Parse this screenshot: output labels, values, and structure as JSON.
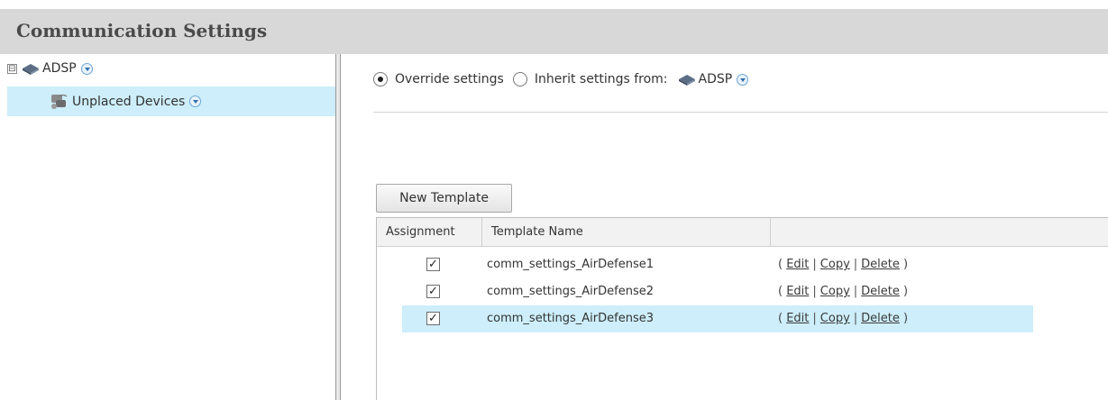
{
  "header": {
    "title": "Communication Settings"
  },
  "tree": {
    "root": {
      "label": "ADSP",
      "expander": "⊟",
      "icon": "site-icon"
    },
    "child": {
      "label": "Unplaced Devices",
      "icon": "devices-icon"
    }
  },
  "settings": {
    "override_label": "Override settings",
    "override_selected": true,
    "inherit_label": "Inherit settings from:",
    "inherit_source": "ADSP"
  },
  "toolbar": {
    "new_template_label": "New Template"
  },
  "table": {
    "columns": [
      "Assignment",
      "Template Name",
      ""
    ],
    "rows": [
      {
        "checked": true,
        "name": "comm_settings_AirDefense1",
        "selected": false
      },
      {
        "checked": true,
        "name": "comm_settings_AirDefense2",
        "selected": false
      },
      {
        "checked": true,
        "name": "comm_settings_AirDefense3",
        "selected": true
      }
    ],
    "actions": {
      "open": "(",
      "edit": "Edit",
      "sep": "|",
      "copy": "Copy",
      "delete": "Delete",
      "close": ")"
    }
  },
  "colors": {
    "selection": "#cdeefa",
    "titlebar": "#d8d8d8",
    "accent": "#2f6fb3"
  }
}
